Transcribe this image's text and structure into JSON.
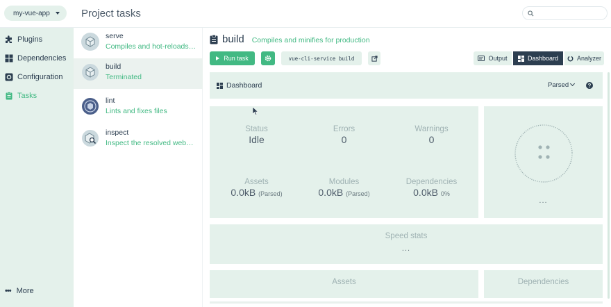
{
  "project": {
    "name": "my-vue-app"
  },
  "header": {
    "title": "Project tasks",
    "search_placeholder": ""
  },
  "sidebar": {
    "items": [
      {
        "label": "Plugins",
        "icon": "puzzle-icon",
        "active": false
      },
      {
        "label": "Dependencies",
        "icon": "grid-icon",
        "active": false
      },
      {
        "label": "Configuration",
        "icon": "gear-icon",
        "active": false
      },
      {
        "label": "Tasks",
        "icon": "clipboard-icon",
        "active": true
      }
    ],
    "more_label": "More"
  },
  "tasks": [
    {
      "name": "serve",
      "description": "Compiles and hot-reloads f...",
      "selected": false
    },
    {
      "name": "build",
      "description": "Terminated",
      "selected": true
    },
    {
      "name": "lint",
      "description": "Lints and fixes files",
      "selected": false
    },
    {
      "name": "inspect",
      "description": "Inspect the resolved webpa...",
      "selected": false
    }
  ],
  "build": {
    "name": "build",
    "description": "Compiles and minifies for production",
    "run_label": "Run task",
    "command": "vue-cli-service build"
  },
  "views": {
    "output": "Output",
    "dashboard": "Dashboard",
    "analyzer": "Analyzer",
    "active": "Dashboard"
  },
  "dashboard": {
    "title": "Dashboard",
    "mode": "Parsed",
    "stats": {
      "status": {
        "label": "Status",
        "value": "Idle"
      },
      "errors": {
        "label": "Errors",
        "value": "0"
      },
      "warnings": {
        "label": "Warnings",
        "value": "0"
      },
      "assets": {
        "label": "Assets",
        "value": "0.0kB",
        "sub": "(Parsed)"
      },
      "modules": {
        "label": "Modules",
        "value": "0.0kB",
        "sub": "(Parsed)"
      },
      "dependencies": {
        "label": "Dependencies",
        "value": "0.0kB",
        "sub": "0%"
      }
    },
    "progress_dots": "...",
    "speed_stats": {
      "label": "Speed stats",
      "dots": "..."
    },
    "assets_label": "Assets",
    "dependencies_label": "Dependencies"
  },
  "colors": {
    "accent": "#42b983",
    "dark": "#2c3e50",
    "panel": "#e4f1eb"
  }
}
